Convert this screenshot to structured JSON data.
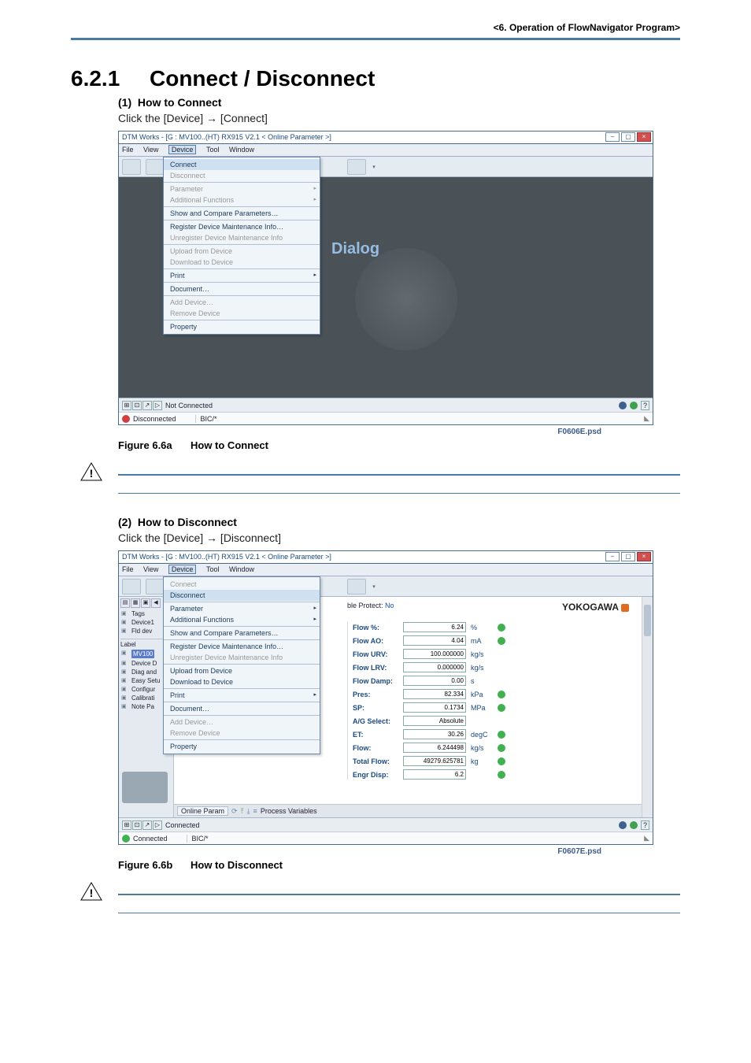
{
  "page": {
    "header_tag": "<6.  Operation of FlowNavigator Program>"
  },
  "section": {
    "num": "6.2.1",
    "title": "Connect / Disconnect",
    "sub1_num": "(1)",
    "sub1_title": "How to Connect",
    "sub1_text": "Click the [Device] → [Connect]",
    "fig1_num": "Figure 6.6a",
    "fig1_title": "How to Connect",
    "fig1_label_right": "F0606E.psd",
    "sub2_num": "(2)",
    "sub2_title": "How to Disconnect",
    "sub2_text": "Click the [Device] → [Disconnect]",
    "fig2_num": "Figure 6.6b",
    "fig2_title": "How to Disconnect",
    "fig2_label_right": "F0607E.psd"
  },
  "app": {
    "title1": "DTM Works - [G : MV100..(HT) RX915 V2.1 < Online Parameter >]",
    "title2": "DTM Works - [G : MV100..(HT) RX915 V2.1 < Online Parameter >]",
    "menu": {
      "file": "File",
      "view": "View",
      "device": "Device",
      "tool": "Tool",
      "window": "Window"
    },
    "device_menu": {
      "connect": "Connect",
      "disconnect": "Disconnect",
      "parameter": "Parameter",
      "additional_functions": "Additional Functions",
      "show_compare": "Show and Compare Parameters…",
      "register": "Register Device Maintenance Info…",
      "unregister": "Unregister Device Maintenance Info",
      "upload": "Upload from Device",
      "download": "Download to Device",
      "print": "Print",
      "document": "Document…",
      "add_device": "Add Device…",
      "remove_device": "Remove Device",
      "property": "Property"
    },
    "dialog_word": "Dialog",
    "status1": {
      "conn": "Not Connected",
      "disc": "Disconnected",
      "brc": "BIC/*"
    },
    "status2": {
      "conn": "Connected",
      "disc": "Connected",
      "brc": "BIC/*",
      "tab": "Online Param"
    },
    "proto_label": "ble Protect:",
    "proto_value": "No",
    "brand": "YOKOGAWA",
    "tree": {
      "label_header": "Label",
      "root": "MV100",
      "device": "Device D",
      "diag": "Diag and",
      "easy": "Easy Setu",
      "config": "Configur",
      "calibrate": "Calibrati",
      "note": "Note Pa",
      "tags": "Tags",
      "device1": "Device1",
      "fld_dev": "Fld dev"
    },
    "footer2": "Process Variables",
    "fields": [
      {
        "label": "Flow %:",
        "value": "6.24",
        "unit": "%",
        "dot": "green"
      },
      {
        "label": "Flow AO:",
        "value": "4.04",
        "unit": "mA",
        "dot": "green"
      },
      {
        "label": "Flow URV:",
        "value": "100.000000",
        "unit": "kg/s",
        "dot": ""
      },
      {
        "label": "Flow LRV:",
        "value": "0.000000",
        "unit": "kg/s",
        "dot": ""
      },
      {
        "label": "Flow Damp:",
        "value": "0.00",
        "unit": "s",
        "dot": ""
      },
      {
        "label": "Pres:",
        "value": "82.334",
        "unit": "kPa",
        "dot": "green"
      },
      {
        "label": "SP:",
        "value": "0.1734",
        "unit": "MPa",
        "dot": "green"
      },
      {
        "label": "A/G Select:",
        "value": "Absolute",
        "unit": "",
        "dot": ""
      },
      {
        "label": "ET:",
        "value": "30.26",
        "unit": "degC",
        "dot": "green"
      },
      {
        "label": "Flow:",
        "value": "6.244498",
        "unit": "kg/s",
        "dot": "green"
      },
      {
        "label": "Total Flow:",
        "value": "49279.625781",
        "unit": "kg",
        "dot": "green"
      },
      {
        "label": "Engr Disp:",
        "value": "6.2",
        "unit": "",
        "dot": "green"
      }
    ]
  }
}
